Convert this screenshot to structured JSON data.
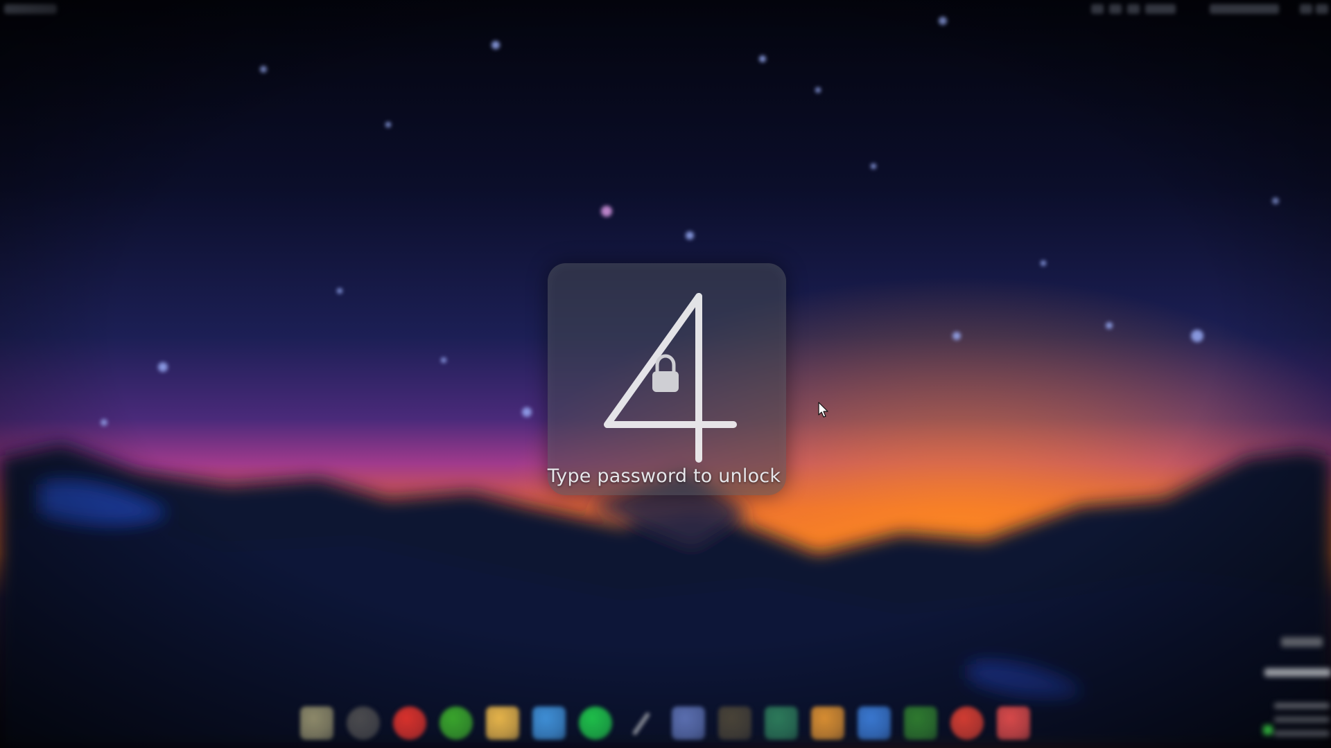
{
  "lock_screen": {
    "digit": "4",
    "prompt": "Type password to unlock"
  },
  "icons": {
    "lock": "lock-icon",
    "pointer": "mouse-pointer-icon"
  },
  "dock": {
    "apps": [
      {
        "name": "file-manager-icon",
        "color": "#8e8a6a"
      },
      {
        "name": "settings-icon",
        "color": "#4b4b4e"
      },
      {
        "name": "browser-shield-icon",
        "color": "#d9322c"
      },
      {
        "name": "chat-icon",
        "color": "#3aa52c"
      },
      {
        "name": "mail-icon",
        "color": "#e6b44a"
      },
      {
        "name": "bird-icon",
        "color": "#3f8fd6"
      },
      {
        "name": "music-icon",
        "color": "#1fbf4a"
      },
      {
        "name": "pen-icon",
        "color": "#3a3d46"
      },
      {
        "name": "photos-icon",
        "color": "#5b6fb0"
      },
      {
        "name": "terminal-icon",
        "color": "#4a4438"
      },
      {
        "name": "vpn-icon",
        "color": "#2d7a5a"
      },
      {
        "name": "archive-icon",
        "color": "#d88e32"
      },
      {
        "name": "document-icon",
        "color": "#3a78d0"
      },
      {
        "name": "spreadsheet-icon",
        "color": "#2f7a2f"
      },
      {
        "name": "help-icon",
        "color": "#d23d32"
      },
      {
        "name": "slideshow-icon",
        "color": "#d84a4a"
      }
    ]
  },
  "colors": {
    "sky_top": "#03040d",
    "sky_mid": "#1a1e4a",
    "horizon_orange": "#ff7a1a",
    "horizon_magenta": "#9a3a8a"
  }
}
